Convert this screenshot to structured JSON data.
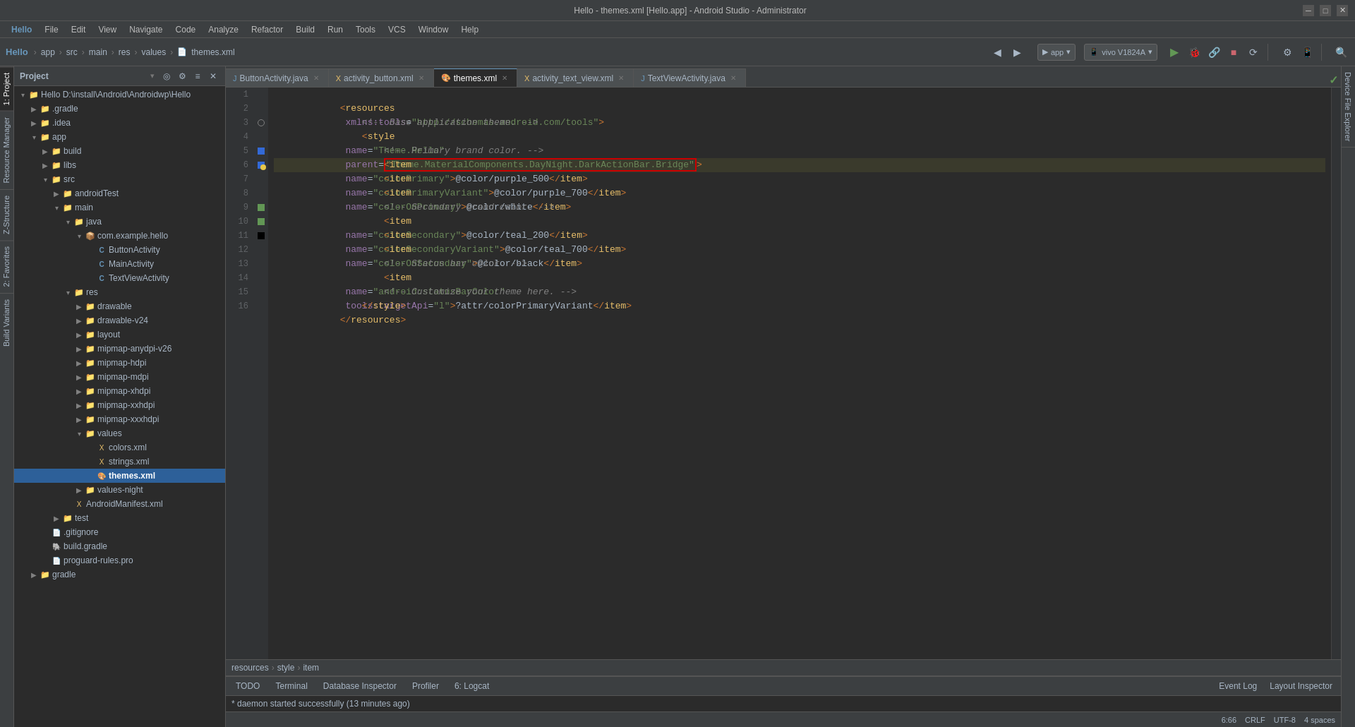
{
  "titleBar": {
    "title": "Hello - themes.xml [Hello.app] - Android Studio - Administrator",
    "minimize": "─",
    "maximize": "□",
    "close": "✕"
  },
  "menuBar": {
    "items": [
      "Hello",
      "File",
      "Edit",
      "View",
      "Navigate",
      "Code",
      "Analyze",
      "Refactor",
      "Build",
      "Run",
      "Tools",
      "VCS",
      "Window",
      "Help"
    ]
  },
  "breadcrumb": {
    "items": [
      "Hello",
      "app",
      "src",
      "main",
      "res",
      "values",
      "themes.xml"
    ]
  },
  "toolbar": {
    "appSelector": "app",
    "deviceSelector": "vivo V1824A"
  },
  "projectPanel": {
    "title": "Project",
    "items": [
      {
        "id": "hello-root",
        "label": "Hello D:\\install\\Android\\Androidwp\\Hello",
        "indent": 0,
        "type": "root",
        "expanded": true
      },
      {
        "id": "gradle",
        "label": ".gradle",
        "indent": 1,
        "type": "folder",
        "expanded": false
      },
      {
        "id": "idea",
        "label": ".idea",
        "indent": 1,
        "type": "folder",
        "expanded": false
      },
      {
        "id": "app",
        "label": "app",
        "indent": 1,
        "type": "folder",
        "expanded": true
      },
      {
        "id": "build",
        "label": "build",
        "indent": 2,
        "type": "folder",
        "expanded": false
      },
      {
        "id": "libs",
        "label": "libs",
        "indent": 2,
        "type": "folder",
        "expanded": false
      },
      {
        "id": "src",
        "label": "src",
        "indent": 2,
        "type": "folder",
        "expanded": true
      },
      {
        "id": "androidTest",
        "label": "androidTest",
        "indent": 3,
        "type": "folder",
        "expanded": false
      },
      {
        "id": "main",
        "label": "main",
        "indent": 3,
        "type": "folder",
        "expanded": true
      },
      {
        "id": "java",
        "label": "java",
        "indent": 4,
        "type": "folder-java",
        "expanded": true
      },
      {
        "id": "com.example.hello",
        "label": "com.example.hello",
        "indent": 5,
        "type": "package",
        "expanded": true
      },
      {
        "id": "ButtonActivity",
        "label": "ButtonActivity",
        "indent": 6,
        "type": "class"
      },
      {
        "id": "MainActivity",
        "label": "MainActivity",
        "indent": 6,
        "type": "class"
      },
      {
        "id": "TextViewActivity",
        "label": "TextViewActivity",
        "indent": 6,
        "type": "class"
      },
      {
        "id": "res",
        "label": "res",
        "indent": 4,
        "type": "folder",
        "expanded": true
      },
      {
        "id": "drawable",
        "label": "drawable",
        "indent": 5,
        "type": "folder",
        "expanded": false
      },
      {
        "id": "drawable-v24",
        "label": "drawable-v24",
        "indent": 5,
        "type": "folder",
        "expanded": false
      },
      {
        "id": "layout",
        "label": "layout",
        "indent": 5,
        "type": "folder",
        "expanded": false
      },
      {
        "id": "mipmap-anydpi-v26",
        "label": "mipmap-anydpi-v26",
        "indent": 5,
        "type": "folder",
        "expanded": false
      },
      {
        "id": "mipmap-hdpi",
        "label": "mipmap-hdpi",
        "indent": 5,
        "type": "folder",
        "expanded": false
      },
      {
        "id": "mipmap-mdpi",
        "label": "mipmap-mdpi",
        "indent": 5,
        "type": "folder",
        "expanded": false
      },
      {
        "id": "mipmap-xhdpi",
        "label": "mipmap-xhdpi",
        "indent": 5,
        "type": "folder",
        "expanded": false
      },
      {
        "id": "mipmap-xxhdpi",
        "label": "mipmap-xxhdpi",
        "indent": 5,
        "type": "folder",
        "expanded": false
      },
      {
        "id": "mipmap-xxxhdpi",
        "label": "mipmap-xxxhdpi",
        "indent": 5,
        "type": "folder",
        "expanded": false
      },
      {
        "id": "values",
        "label": "values",
        "indent": 5,
        "type": "folder",
        "expanded": true
      },
      {
        "id": "colors.xml",
        "label": "colors.xml",
        "indent": 6,
        "type": "xml"
      },
      {
        "id": "strings.xml",
        "label": "strings.xml",
        "indent": 6,
        "type": "xml"
      },
      {
        "id": "themes.xml",
        "label": "themes.xml",
        "indent": 6,
        "type": "xml",
        "selected": true
      },
      {
        "id": "values-night",
        "label": "values-night",
        "indent": 5,
        "type": "folder",
        "expanded": false
      },
      {
        "id": "AndroidManifest.xml",
        "label": "AndroidManifest.xml",
        "indent": 4,
        "type": "xml"
      },
      {
        "id": "test",
        "label": "test",
        "indent": 3,
        "type": "folder",
        "expanded": false
      },
      {
        "id": ".gitignore",
        "label": ".gitignore",
        "indent": 2,
        "type": "file"
      },
      {
        "id": "build.gradle",
        "label": "build.gradle",
        "indent": 2,
        "type": "gradle"
      },
      {
        "id": "proguard-rules.pro",
        "label": "proguard-rules.pro",
        "indent": 2,
        "type": "file"
      },
      {
        "id": "gradle2",
        "label": "gradle",
        "indent": 1,
        "type": "folder",
        "expanded": false
      }
    ]
  },
  "editorTabs": [
    {
      "label": "ButtonActivity.java",
      "type": "java",
      "active": false
    },
    {
      "label": "activity_button.xml",
      "type": "xml",
      "active": false
    },
    {
      "label": "themes.xml",
      "type": "xml",
      "active": true
    },
    {
      "label": "activity_text_view.xml",
      "type": "xml",
      "active": false
    },
    {
      "label": "TextViewActivity.java",
      "type": "java",
      "active": false
    }
  ],
  "codeLines": [
    {
      "num": 1,
      "content": "<resources xmlns:tools=\"http://schemas.android.com/tools\">"
    },
    {
      "num": 2,
      "content": "    <!-- Base application theme. -->"
    },
    {
      "num": 3,
      "content": "    <style name=\"Theme.Hello\" parent=\"Theme.MaterialComponents.DayNight.DarkActionBar.Bridge\">",
      "highlight": true
    },
    {
      "num": 4,
      "content": "        <!-- Primary brand color. -->"
    },
    {
      "num": 5,
      "content": "        <item name=\"colorPrimary\">@color/purple_500</item>",
      "colorMark": "purple"
    },
    {
      "num": 6,
      "content": "        <item name=\"colorPrimaryVariant\">@color/purple_700</item>",
      "colorMark": "purple-dark",
      "highlighted": true
    },
    {
      "num": 7,
      "content": "        <item name=\"colorOnPrimary\">@color/white</item>"
    },
    {
      "num": 8,
      "content": "        <!-- Secondary brand color. -->"
    },
    {
      "num": 9,
      "content": "        <item name=\"colorSecondary\">@color/teal_200</item>",
      "colorMark": "teal"
    },
    {
      "num": 10,
      "content": "        <item name=\"colorSecondaryVariant\">@color/teal_700</item>",
      "colorMark": "teal-dark"
    },
    {
      "num": 11,
      "content": "        <item name=\"colorOnSecondary\">@color/black</item>",
      "colorMark": "black"
    },
    {
      "num": 12,
      "content": "        <!-- Status bar color. -->"
    },
    {
      "num": 13,
      "content": "        <item name=\"android:statusBarColor\" tools:targetApi=\"l\">?attr/colorPrimaryVariant</item>"
    },
    {
      "num": 14,
      "content": "        <!-- Customize your theme here. -->"
    },
    {
      "num": 15,
      "content": "    </style>"
    },
    {
      "num": 16,
      "content": "</resources>"
    }
  ],
  "bottomBreadcrumb": {
    "items": [
      "resources",
      "style",
      "item"
    ]
  },
  "bottomTabs": [
    {
      "label": "TODO",
      "active": false
    },
    {
      "label": "Terminal",
      "active": false
    },
    {
      "label": "Database Inspector",
      "active": false
    },
    {
      "label": "Profiler",
      "active": false
    },
    {
      "label": "6: Logcat",
      "active": false
    }
  ],
  "bottomStatusRight": [
    {
      "label": "Event Log"
    },
    {
      "label": "Layout Inspector"
    }
  ],
  "statusBar": {
    "left": "* daemon started successfully (13 minutes ago)",
    "position": "6:66",
    "lineEnding": "CRLF",
    "encoding": "UTF-8",
    "indent": "4 spaces"
  },
  "rightSideTabs": [
    "Device File Explorer"
  ],
  "leftSideTabs": [
    "1: Project",
    "Resource Manager",
    "Z-Structure",
    "2: Favorites",
    "Build Variants"
  ]
}
